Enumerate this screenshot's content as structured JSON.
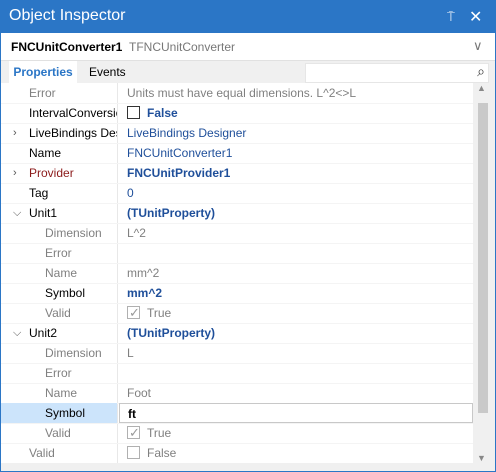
{
  "window": {
    "title": "Object Inspector",
    "pin_glyph": "⍑",
    "close_glyph": "✕"
  },
  "selector": {
    "component_name": "FNCUnitConverter1",
    "component_type": "TFNCUnitConverter",
    "dropdown_glyph": "∨"
  },
  "tabs": {
    "properties": "Properties",
    "events": "Events",
    "search_placeholder": ""
  },
  "rows": [
    {
      "name": "Error",
      "value": "Units must have equal dimensions. L^2<>L"
    },
    {
      "name": "IntervalConversion",
      "value": "False"
    },
    {
      "name": "LiveBindings Designer",
      "value": "LiveBindings Designer"
    },
    {
      "name": "Name",
      "value": "FNCUnitConverter1"
    },
    {
      "name": "Provider",
      "value": "FNCUnitProvider1"
    },
    {
      "name": "Tag",
      "value": "0"
    },
    {
      "name": "Unit1",
      "value": "(TUnitProperty)"
    },
    {
      "name": "Dimension",
      "value": "L^2"
    },
    {
      "name": "Error",
      "value": ""
    },
    {
      "name": "Name",
      "value": "mm^2"
    },
    {
      "name": "Symbol",
      "value": "mm^2"
    },
    {
      "name": "Valid",
      "value": "True"
    },
    {
      "name": "Unit2",
      "value": "(TUnitProperty)"
    },
    {
      "name": "Dimension",
      "value": "L"
    },
    {
      "name": "Error",
      "value": ""
    },
    {
      "name": "Name",
      "value": "Foot"
    },
    {
      "name": "Symbol",
      "value": "ft"
    },
    {
      "name": "Valid",
      "value": "True"
    },
    {
      "name": "Valid",
      "value": "False"
    }
  ],
  "icons": {
    "expand_closed": "›",
    "expand_open": "⌵",
    "search": "⌕",
    "check": "✓"
  },
  "colors": {
    "accent": "#2b76c6",
    "link": "#1f4f9a",
    "readonly": "#808080",
    "selected": "#cce4fb"
  }
}
